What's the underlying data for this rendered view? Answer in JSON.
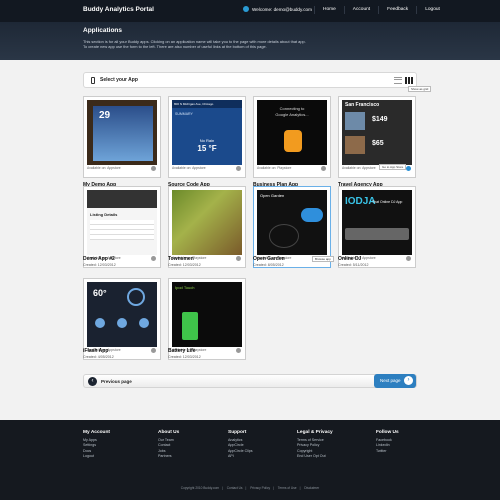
{
  "header": {
    "brand": "Buddy Analytics Portal",
    "welcome": "Welcome: demo@buddy.com",
    "nav": [
      "Home",
      "Account",
      "Feedback",
      "Logout"
    ]
  },
  "hero": {
    "title": "Applications",
    "lines": [
      "This section is for all your Buddy apps. Clicking on an application name will take you to the page with more details about that app.",
      "To create new app use the form to the left. There are also number of useful links at the bottom of this page."
    ]
  },
  "panel": {
    "title": "Select your App",
    "tooltip_grid": "Show as grid"
  },
  "apps": [
    {
      "name": "My Demo App",
      "created": "Created: 5/05/2012",
      "platform": "Available on: Appstore"
    },
    {
      "name": "Source Code App",
      "created": "Created: 12/03/2012",
      "platform": "Available on: Appstore"
    },
    {
      "name": "Business Plan App",
      "created": "Created: 8/05/2012",
      "platform": "Available on: Playstore"
    },
    {
      "name": "Travel Agency App",
      "created": "Created: 5/11/2012",
      "platform": "Available on: Appstore"
    },
    {
      "name": "Demo App #2",
      "created": "Created: 12/03/2012",
      "platform": "Available on: Appstore"
    },
    {
      "name": "Townsmen",
      "created": "Created: 12/03/2012",
      "platform": "Available on: Playstore"
    },
    {
      "name": "Open Garden",
      "created": "Created: 8/05/2012",
      "platform": "Available on: Playstore"
    },
    {
      "name": "Online DJ",
      "created": "Created: 5/11/2012",
      "platform": "Available on: Appstore"
    },
    {
      "name": "iFlash App",
      "created": "Created: 4/05/2012",
      "platform": "Available on: Appstore"
    },
    {
      "name": "Battery Life",
      "created": "Created: 12/03/2012",
      "platform": "Available on: Playstore"
    }
  ],
  "thumbs": {
    "source_code": {
      "addr": "800 N Michigan Ave, Chicago",
      "label": "SUMMARY",
      "temp": "15 °F",
      "weather": "No Rain"
    },
    "business": {
      "line1": "Connecting to",
      "line2": "Google Analytics..."
    },
    "travel": {
      "city": "San Francisco",
      "price1": "$149",
      "price2": "$65"
    },
    "online_dj": {
      "title": "That Online DJ App"
    },
    "battery": {
      "title": "Ipod Touch"
    },
    "flash": {
      "deg": "60°"
    },
    "garden": {
      "title": "Open Garden"
    },
    "demo2": {
      "title": "Listing Details"
    }
  },
  "tooltips": {
    "tip2": "Go to App Store",
    "tip3": "Browse app"
  },
  "pager": {
    "prev": "Previous page",
    "next": "Next page"
  },
  "footer": {
    "cols": [
      {
        "title": "My Account",
        "links": [
          "My Apps",
          "Settings",
          "Docs",
          "Logout"
        ]
      },
      {
        "title": "About Us",
        "links": [
          "Our Team",
          "Contact",
          "Jobs",
          "Partners"
        ]
      },
      {
        "title": "Support",
        "links": [
          "Analytics",
          "AppCircle",
          "AppCircle Clips",
          "API"
        ]
      },
      {
        "title": "Legal & Privacy",
        "links": [
          "Terms of Service",
          "Privacy Policy",
          "Copyright",
          "End User Opt Out"
        ]
      },
      {
        "title": "Follow Us",
        "links": [
          "Facebook",
          "LinkedIn",
          "Twitter"
        ]
      }
    ],
    "bottom": [
      "Copyright 2010 Buddy.com",
      "Contact Us",
      "Privacy Policy",
      "Terms of Use",
      "Disclaimer"
    ]
  }
}
